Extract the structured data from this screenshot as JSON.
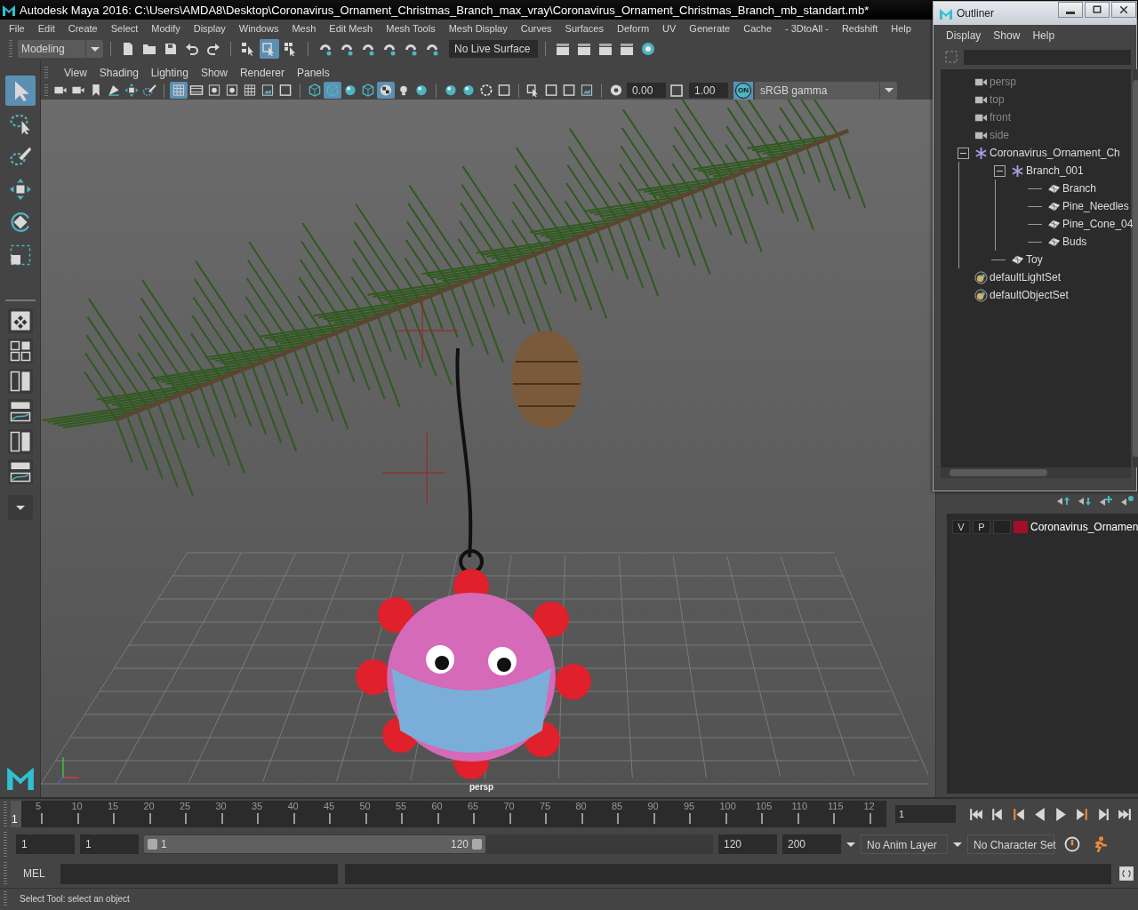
{
  "window": {
    "title": "Autodesk Maya 2016: C:\\Users\\AMDA8\\Desktop\\Coronavirus_Ornament_Christmas_Branch_max_vray\\Coronavirus_Ornament_Christmas_Branch_mb_standart.mb*"
  },
  "menu": [
    "File",
    "Edit",
    "Create",
    "Select",
    "Modify",
    "Display",
    "Windows",
    "Mesh",
    "Edit Mesh",
    "Mesh Tools",
    "Mesh Display",
    "Curves",
    "Surfaces",
    "Deform",
    "UV",
    "Generate",
    "Cache",
    "- 3DtoAll -",
    "Redshift",
    "Help"
  ],
  "shelf": {
    "workspace": "Modeling",
    "live_surface": "No Live Surface",
    "icons": [
      {
        "kind": "page",
        "selected": false
      },
      {
        "kind": "folder",
        "selected": false
      },
      {
        "kind": "save",
        "selected": false
      },
      {
        "kind": "undo",
        "selected": false
      },
      {
        "kind": "redo",
        "selected": false
      },
      {
        "kind": "sep"
      },
      {
        "kind": "hierarchy",
        "selected": false
      },
      {
        "kind": "objsel",
        "selected": true
      },
      {
        "kind": "compsel",
        "selected": false
      },
      {
        "kind": "sep"
      },
      {
        "kind": "magnet",
        "selected": false
      },
      {
        "kind": "magnet",
        "selected": false
      },
      {
        "kind": "magnet",
        "selected": false
      },
      {
        "kind": "magnet",
        "selected": false
      },
      {
        "kind": "magnet",
        "selected": false
      },
      {
        "kind": "magnet",
        "selected": false
      }
    ],
    "render_icons": [
      {
        "kind": "clapper",
        "selected": false
      },
      {
        "kind": "clapper",
        "selected": false
      },
      {
        "kind": "clapper",
        "selected": false
      },
      {
        "kind": "clapper",
        "selected": false
      },
      {
        "kind": "target",
        "selected": false
      }
    ]
  },
  "toolbox": [
    {
      "kind": "arrow",
      "selected": true
    },
    {
      "kind": "lasso",
      "selected": false
    },
    {
      "kind": "brush",
      "selected": false
    },
    {
      "kind": "move",
      "selected": false
    },
    {
      "kind": "rotate",
      "selected": false
    },
    {
      "kind": "scale",
      "selected": false
    }
  ],
  "viewport": {
    "menu": [
      "View",
      "Shading",
      "Lighting",
      "Show",
      "Renderer",
      "Panels"
    ],
    "icons": [
      {
        "kind": "camera",
        "selected": false
      },
      {
        "kind": "camera",
        "selected": false
      },
      {
        "kind": "bookmark",
        "selected": false
      },
      {
        "kind": "plane",
        "selected": false
      },
      {
        "kind": "move",
        "selected": false
      },
      {
        "kind": "brush",
        "selected": false
      },
      {
        "kind": "sep"
      },
      {
        "kind": "grid",
        "selected": true
      },
      {
        "kind": "film",
        "selected": false
      },
      {
        "kind": "dot",
        "selected": false
      },
      {
        "kind": "dot",
        "selected": false
      },
      {
        "kind": "grid",
        "selected": false
      },
      {
        "kind": "image",
        "selected": false
      },
      {
        "kind": "square",
        "selected": false
      },
      {
        "kind": "sep"
      },
      {
        "kind": "cube",
        "selected": false
      },
      {
        "kind": "cube",
        "selected": true
      },
      {
        "kind": "sphere",
        "selected": false
      },
      {
        "kind": "cube",
        "selected": false
      },
      {
        "kind": "checker",
        "selected": true
      },
      {
        "kind": "light",
        "selected": false
      },
      {
        "kind": "sphere",
        "selected": false
      },
      {
        "kind": "sep"
      },
      {
        "kind": "sphere",
        "selected": false
      },
      {
        "kind": "sphere",
        "selected": false
      },
      {
        "kind": "ring",
        "selected": false
      },
      {
        "kind": "square",
        "selected": false
      },
      {
        "kind": "sep"
      },
      {
        "kind": "objsel",
        "selected": false
      },
      {
        "kind": "square",
        "selected": false
      },
      {
        "kind": "square",
        "selected": false
      },
      {
        "kind": "image",
        "selected": false
      },
      {
        "kind": "sep"
      },
      {
        "kind": "aperture",
        "selected": false
      }
    ],
    "exposure": "0.00",
    "gamma": "1.00",
    "color_management": {
      "label": "ON",
      "on": true
    },
    "view_transform": "sRGB gamma",
    "camera_label": "persp"
  },
  "outliner": {
    "title": "Outliner",
    "menu": [
      "Display",
      "Show",
      "Help"
    ],
    "items": [
      {
        "name": "persp",
        "kind": "camera"
      },
      {
        "name": "top",
        "kind": "camera"
      },
      {
        "name": "front",
        "kind": "camera"
      },
      {
        "name": "side",
        "kind": "camera"
      },
      {
        "name": "Coronavirus_Ornament_Ch",
        "kind": "group",
        "expanded": true,
        "children": [
          {
            "name": "Branch_001",
            "kind": "group",
            "expanded": true,
            "children": [
              {
                "name": "Branch",
                "kind": "mesh"
              },
              {
                "name": "Pine_Needles",
                "kind": "mesh"
              },
              {
                "name": "Pine_Cone_04",
                "kind": "mesh"
              },
              {
                "name": "Buds",
                "kind": "mesh"
              }
            ]
          },
          {
            "name": "Toy",
            "kind": "mesh"
          }
        ]
      },
      {
        "name": "defaultLightSet",
        "kind": "set"
      },
      {
        "name": "defaultObjectSet",
        "kind": "set"
      }
    ]
  },
  "layers": [
    {
      "visible": "V",
      "playback": "P",
      "color": "#a0102a",
      "name": "Coronavirus_Ornamen"
    }
  ],
  "timeline": {
    "current": "1",
    "level": 0,
    "ticks": [
      "5",
      "10",
      "15",
      "20",
      "25",
      "30",
      "35",
      "40",
      "45",
      "50",
      "55",
      "60",
      "65",
      "70",
      "75",
      "80",
      "85",
      "90",
      "95",
      "100",
      "105",
      "110",
      "115",
      "12"
    ],
    "frame": "1"
  },
  "range": {
    "start": "1",
    "playback_start": "1",
    "slider_start": "1",
    "slider_end": "120",
    "level": 0.6,
    "playback_end": "120",
    "end": "200",
    "anim_layer": "No Anim Layer",
    "character_set": "No Character Set"
  },
  "command_line": {
    "label": "MEL"
  },
  "status": "Select Tool: select an object"
}
